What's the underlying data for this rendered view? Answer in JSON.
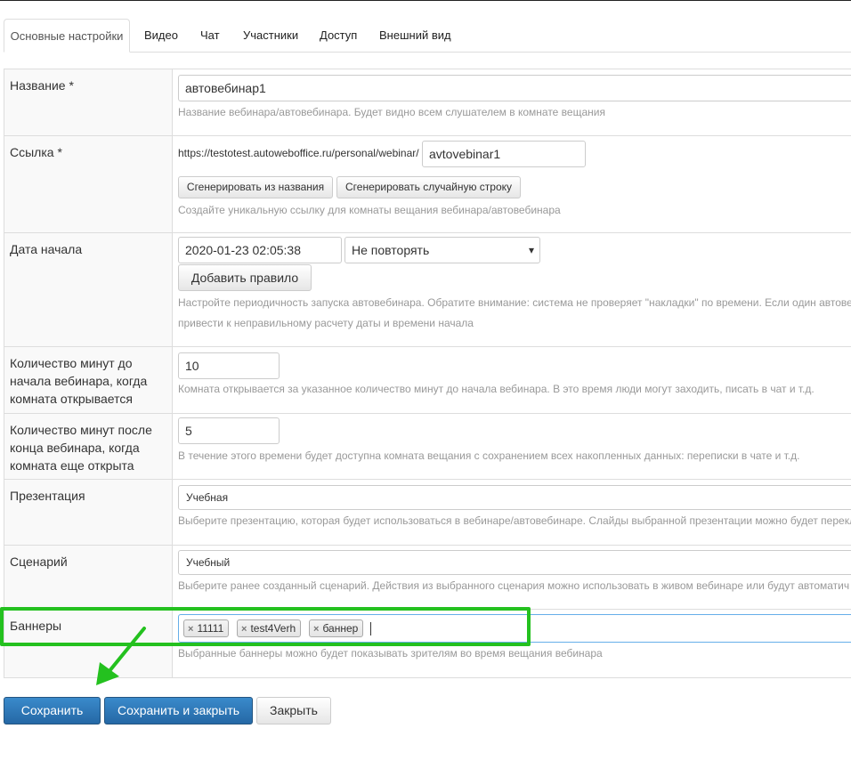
{
  "tabs": [
    {
      "label": "Основные настройки"
    },
    {
      "label": "Видео"
    },
    {
      "label": "Чат"
    },
    {
      "label": "Участники"
    },
    {
      "label": "Доступ"
    },
    {
      "label": "Внешний вид"
    }
  ],
  "fields": {
    "name": {
      "label": "Название *",
      "value": "автовебинар1",
      "help": "Название вебинара/автовебинара. Будет видно всем слушателем в комнате вещания"
    },
    "link": {
      "label": "Ссылка *",
      "prefix": "https://testotest.autoweboffice.ru/personal/webinar/",
      "value": "avtovebinar1",
      "btn_from_name": "Сгенерировать из названия",
      "btn_random": "Сгенерировать случайную строку",
      "help": "Создайте уникальную ссылку для комнаты вещания вебинара/автовебинара"
    },
    "start_date": {
      "label": "Дата начала",
      "value": "2020-01-23 02:05:38",
      "repeat": "Не повторять",
      "add_rule": "Добавить правило",
      "help_line1": "Настройте периодичность запуска автовебинара. Обратите внимание: система не проверяет \"накладки\" по времени. Если один автове",
      "help_line2": "привести к неправильному расчету даты и времени начала"
    },
    "minutes_before": {
      "label": "Количество минут до начала вебинара, когда комната открывается",
      "value": "10",
      "help": "Комната открывается за указанное количество минут до начала вебинара. В это время люди могут заходить, писать в чат и т.д."
    },
    "minutes_after": {
      "label": "Количество минут после конца вебинара, когда комната еще открыта",
      "value": "5",
      "help": "В течение этого времени будет доступна комната вещания с сохранением всех накопленных данных: переписки в чате и т.д."
    },
    "presentation": {
      "label": "Презентация",
      "value": "Учебная",
      "help": "Выберите презентацию, которая будет использоваться в вебинаре/автовебинаре. Слайды выбранной презентации можно будет перекл"
    },
    "scenario": {
      "label": "Сценарий",
      "value": "Учебный",
      "help": "Выберите ранее созданный сценарий. Действия из выбранного сценария можно использовать в живом вебинаре или будут автоматич"
    },
    "banners": {
      "label": "Баннеры",
      "tags": [
        "11111",
        "test4Verh",
        "баннер"
      ],
      "help": "Выбранные баннеры можно будет показывать зрителям во время вещания вебинара"
    }
  },
  "actions": {
    "save": "Сохранить",
    "save_close": "Сохранить и закрыть",
    "close": "Закрыть"
  },
  "colors": {
    "highlight": "#24c11f",
    "primary": "#2f7bbf"
  },
  "icons": {
    "tag_remove": "×",
    "select_caret": "▾"
  }
}
